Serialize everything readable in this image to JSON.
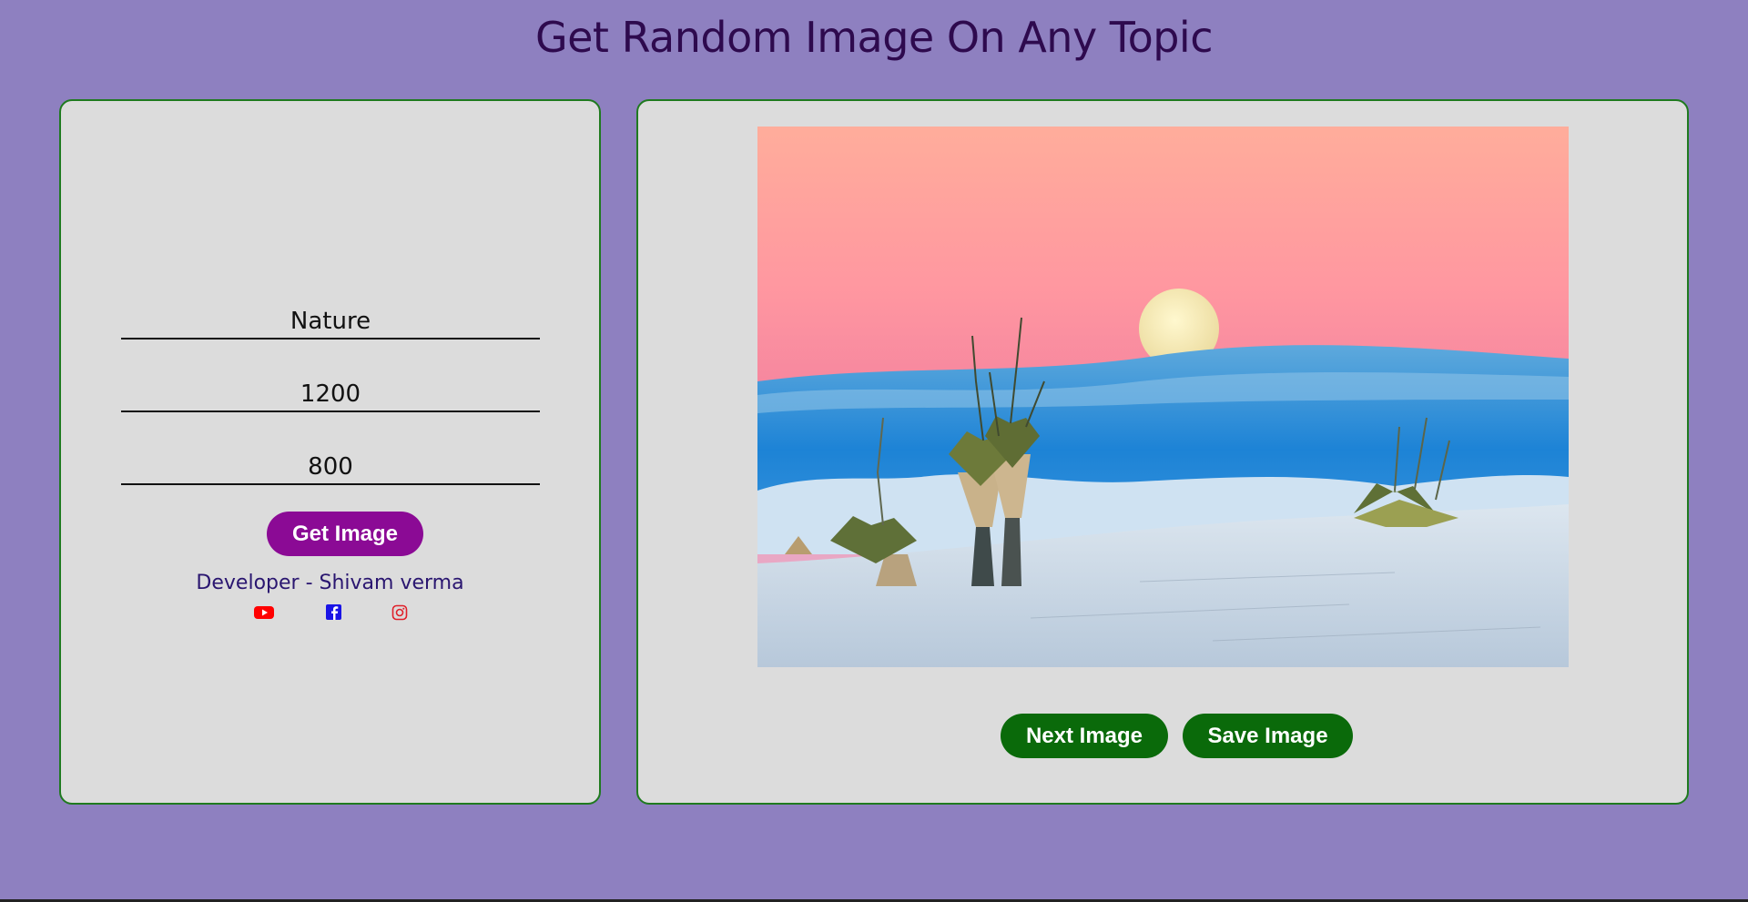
{
  "header": {
    "title": "Get Random Image On Any Topic"
  },
  "form": {
    "topic_value": "Nature",
    "width_value": "1200",
    "height_value": "800",
    "get_button_label": "Get Image"
  },
  "credits": {
    "developer_text": "Developer - Shivam verma",
    "social_icons": [
      "youtube-icon",
      "facebook-icon",
      "instagram-icon"
    ]
  },
  "viewer": {
    "image_icon": "desert-moon-photo",
    "next_button_label": "Next Image",
    "save_button_label": "Save Image"
  },
  "colors": {
    "background": "#8e80c0",
    "panel": "#dcdcdc",
    "panel_border": "#1f7a1f",
    "title": "#2e0a4e",
    "get_button": "#8b0a95",
    "action_buttons": "#0a6a0a",
    "youtube": "#ff0000",
    "facebook": "#1a14e6",
    "instagram": "#e0202a"
  }
}
